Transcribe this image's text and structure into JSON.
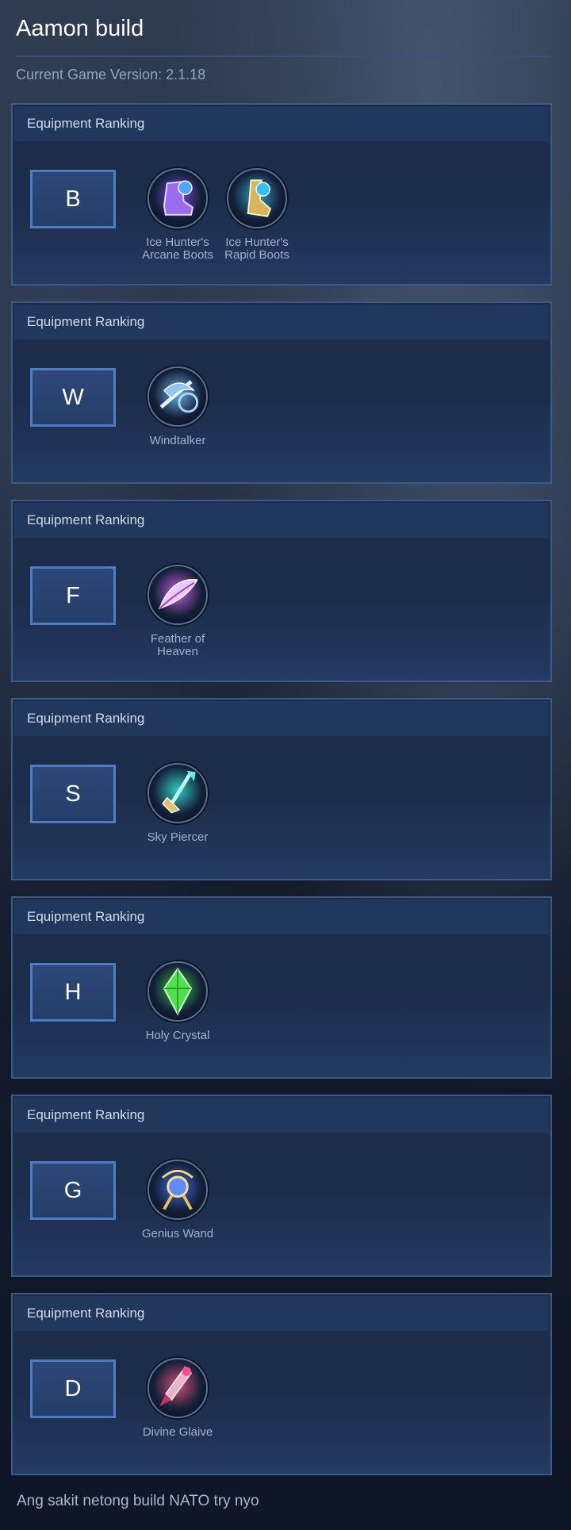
{
  "header": {
    "title": "Aamon build",
    "version": "Current Game Version: 2.1.18"
  },
  "cards": [
    {
      "heading": "Equipment Ranking",
      "tier": "B",
      "items": [
        {
          "name": "Ice Hunter's Arcane Boots",
          "icon": "arcane-boots-icon",
          "color": "#7a4ad6"
        },
        {
          "name": "Ice Hunter's Rapid Boots",
          "icon": "rapid-boots-icon",
          "color": "#2fa4c9"
        }
      ]
    },
    {
      "heading": "Equipment Ranking",
      "tier": "W",
      "items": [
        {
          "name": "Windtalker",
          "icon": "windtalker-icon",
          "color": "#6fb3e8"
        }
      ]
    },
    {
      "heading": "Equipment Ranking",
      "tier": "F",
      "items": [
        {
          "name": "Feather of Heaven",
          "icon": "feather-icon",
          "color": "#c45fe0"
        }
      ]
    },
    {
      "heading": "Equipment Ranking",
      "tier": "S",
      "items": [
        {
          "name": "Sky Piercer",
          "icon": "sky-piercer-icon",
          "color": "#2fd1c4"
        }
      ]
    },
    {
      "heading": "Equipment Ranking",
      "tier": "H",
      "items": [
        {
          "name": "Holy Crystal",
          "icon": "holy-crystal-icon",
          "color": "#35c43a"
        }
      ]
    },
    {
      "heading": "Equipment Ranking",
      "tier": "G",
      "items": [
        {
          "name": "Genius Wand",
          "icon": "genius-wand-icon",
          "color": "#3f6be0"
        }
      ]
    },
    {
      "heading": "Equipment Ranking",
      "tier": "D",
      "items": [
        {
          "name": "Divine Glaive",
          "icon": "divine-glaive-icon",
          "color": "#d64c73"
        }
      ]
    }
  ],
  "comment": "Ang sakit netong build NATO try nyo"
}
